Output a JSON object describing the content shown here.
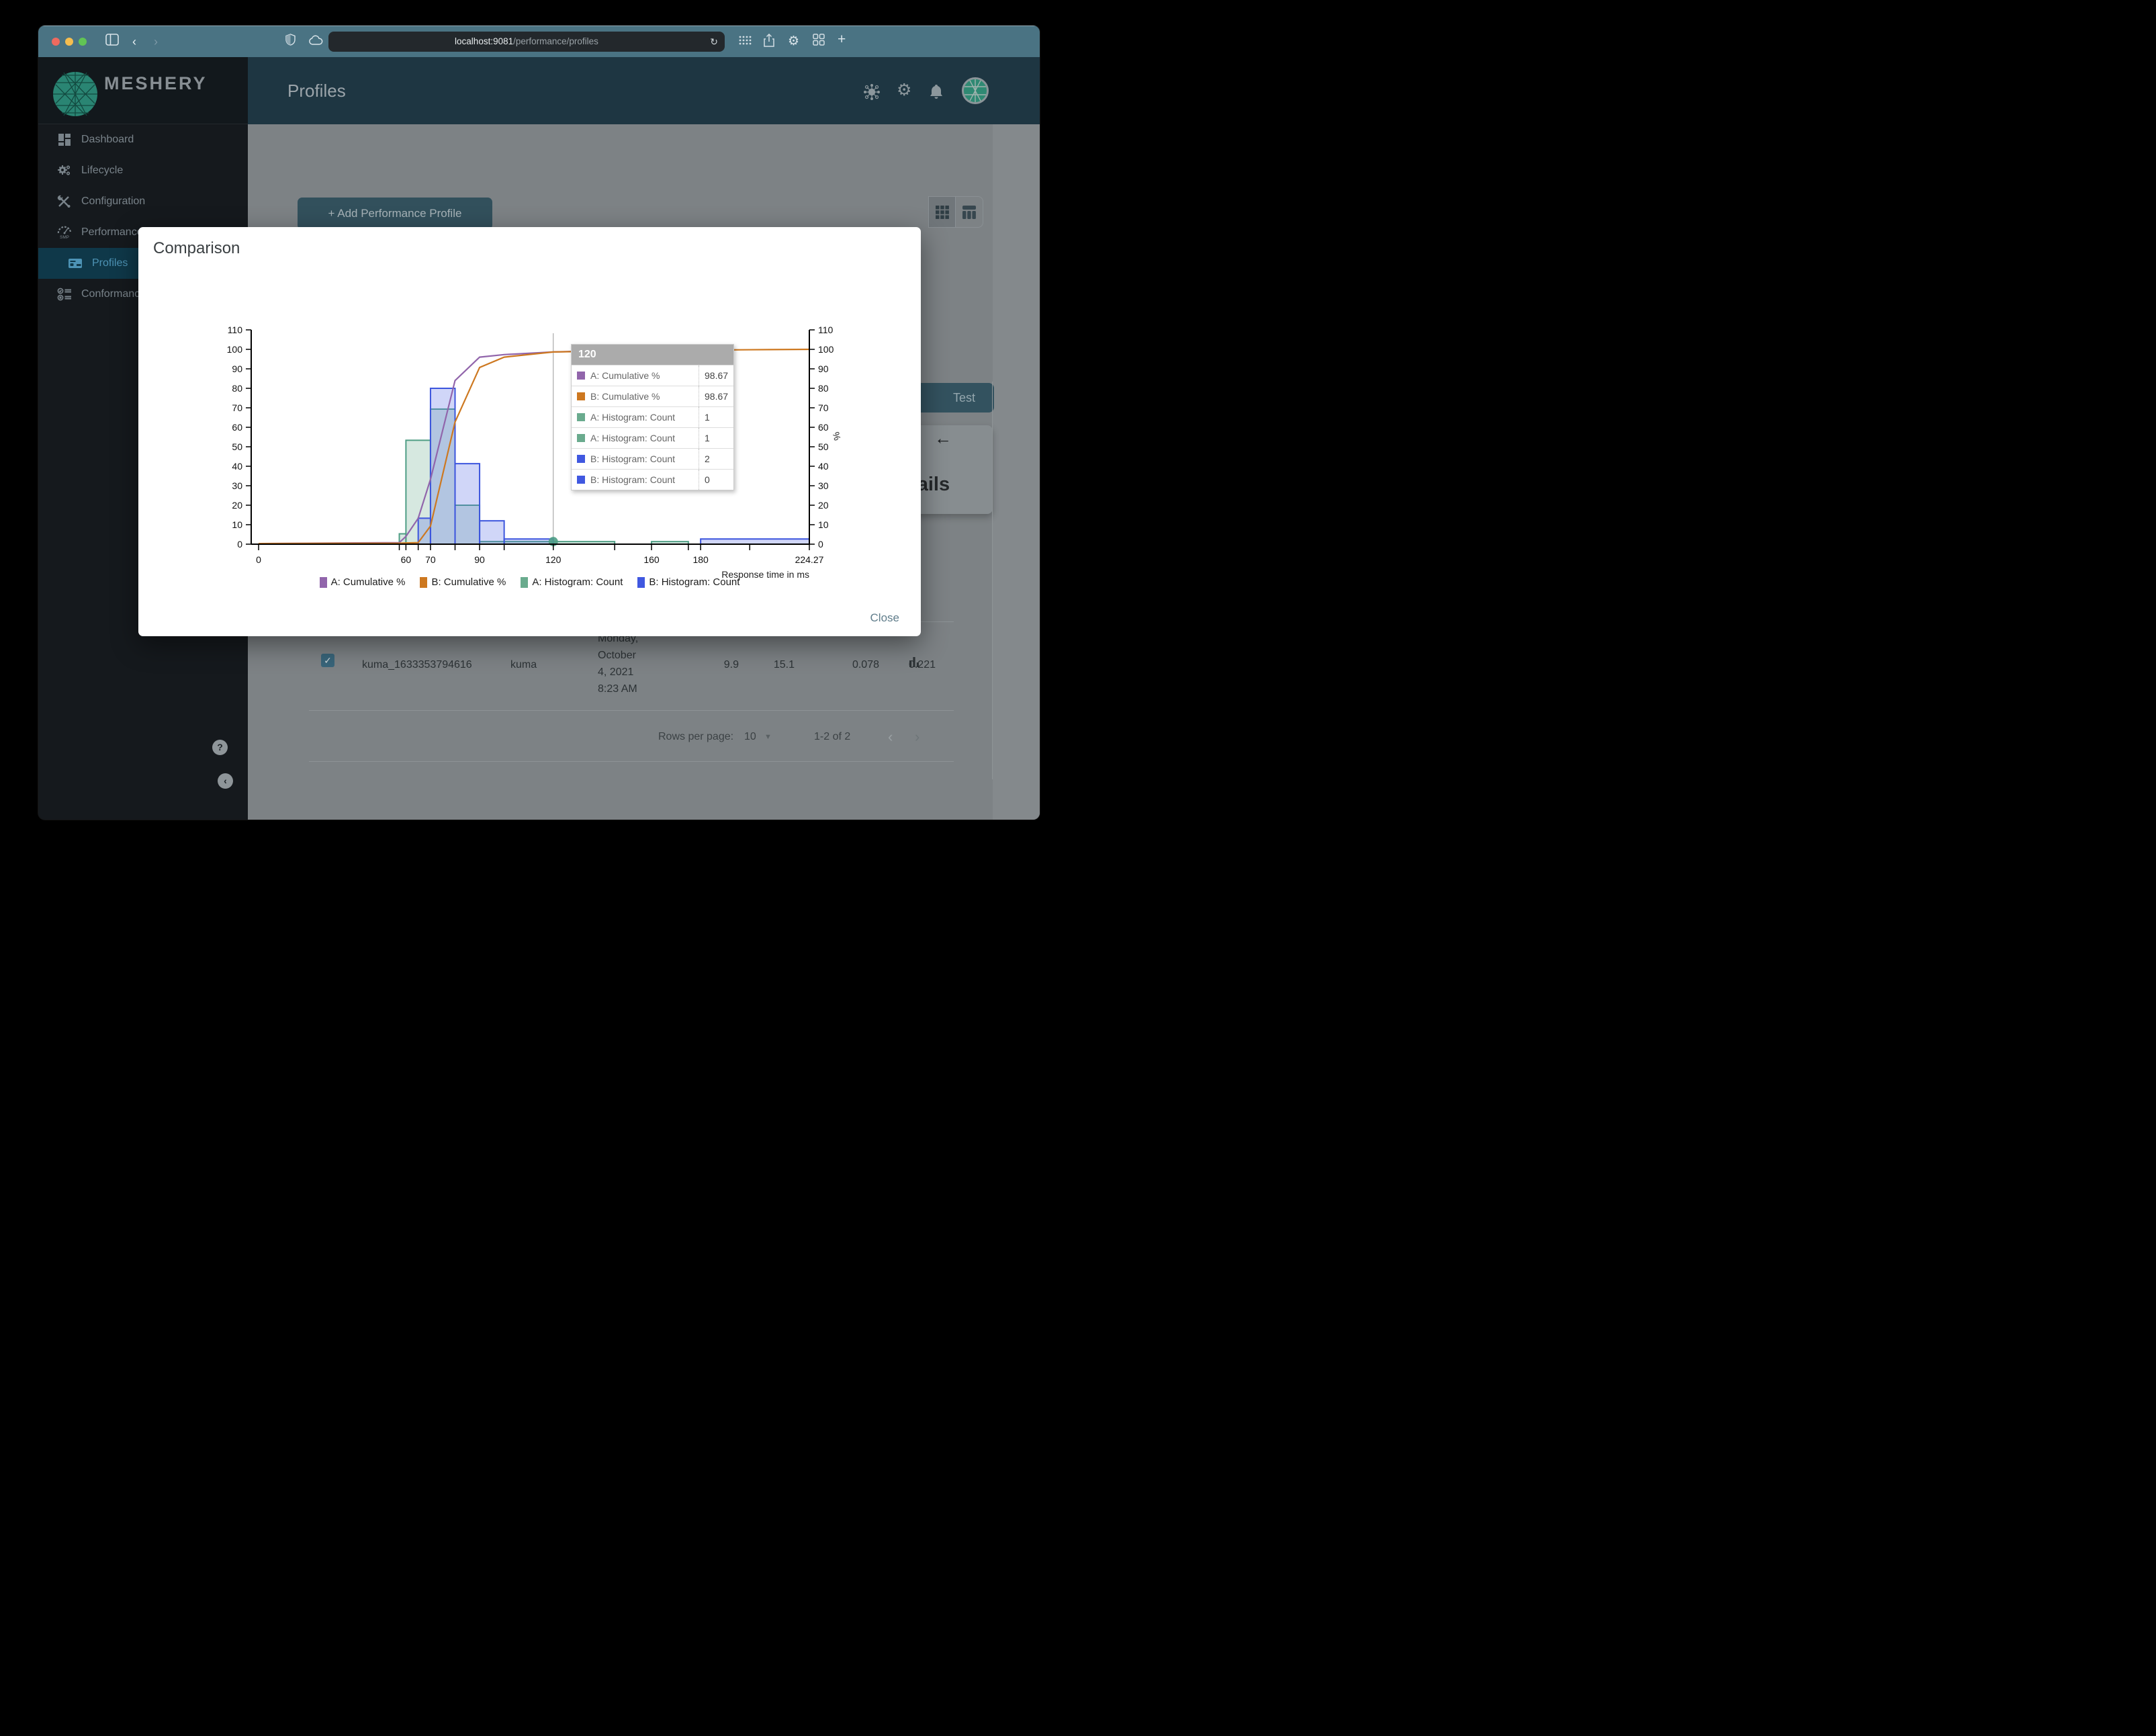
{
  "browser": {
    "url_host": "localhost:9081",
    "url_path": "/performance/profiles"
  },
  "sidebar": {
    "brand": "MESHERY",
    "items": [
      {
        "label": "Dashboard",
        "icon": "dashboard-icon",
        "active": false,
        "indent": false
      },
      {
        "label": "Lifecycle",
        "icon": "lifecycle-icon",
        "active": false,
        "indent": false
      },
      {
        "label": "Configuration",
        "icon": "configuration-icon",
        "active": false,
        "indent": false
      },
      {
        "label": "Performance",
        "icon": "performance-icon",
        "active": false,
        "indent": false
      },
      {
        "label": "Profiles",
        "icon": "profiles-icon",
        "active": true,
        "indent": true
      },
      {
        "label": "Conformance",
        "icon": "conformance-icon",
        "active": false,
        "indent": false
      }
    ],
    "help_label": "?",
    "collapse_label": "‹"
  },
  "header": {
    "title": "Profiles"
  },
  "content": {
    "add_profile_button": "+ Add Performance Profile",
    "test_button": "Test",
    "back_arrow": "←",
    "details_heading": "Details",
    "table_row": {
      "name": "kuma_1633353794616",
      "mesh": "kuma",
      "date_lines": [
        "Monday,",
        "October",
        "4, 2021",
        "8:23 AM"
      ],
      "qps": "9.9",
      "duration": "15.1",
      "p50": "0.078",
      "p99": "0.221"
    },
    "pagination": {
      "rows_per_page_label": "Rows per page:",
      "rows_per_page_value": "10",
      "range": "1-2 of 2",
      "prev": "‹",
      "next": "›"
    }
  },
  "modal": {
    "title": "Comparison",
    "close_label": "Close",
    "tooltip": {
      "title": "120",
      "rows": [
        {
          "name": "A: Cumulative %",
          "value": "98.67",
          "color": "#9165ab"
        },
        {
          "name": "B: Cumulative %",
          "value": "98.67",
          "color": "#cd7820"
        },
        {
          "name": "A: Histogram: Count",
          "value": "1",
          "color": "#6aab8e"
        },
        {
          "name": "A: Histogram: Count",
          "value": "1",
          "color": "#6aab8e"
        },
        {
          "name": "B: Histogram: Count",
          "value": "2",
          "color": "#4058e0"
        },
        {
          "name": "B: Histogram: Count",
          "value": "0",
          "color": "#4058e0"
        }
      ]
    }
  },
  "chart_data": {
    "type": "mixed: histogram bars + cumulative % lines",
    "title": "",
    "xlabel": "Response time in ms",
    "ylabel_right": "%",
    "xlim": [
      0,
      224.27
    ],
    "ylim": [
      0,
      110
    ],
    "x_tick_labels": [
      "0",
      "60",
      "70",
      "90",
      "120",
      "160",
      "180",
      "224.27"
    ],
    "x_tick_label_values": [
      0,
      60,
      70,
      90,
      120,
      160,
      180,
      224.27
    ],
    "x_minor_ticks": [
      0,
      57.3,
      60,
      65,
      70,
      80,
      90,
      100,
      120,
      145,
      160,
      175,
      180,
      200,
      224.27
    ],
    "y_ticks": [
      0,
      10,
      20,
      30,
      40,
      50,
      60,
      70,
      80,
      90,
      100,
      110
    ],
    "grid": "off",
    "legend_position": "bottom",
    "crosshair_x": 120,
    "marker": {
      "x": 120,
      "y": 1.33,
      "color": "#4f9e85"
    },
    "series": [
      {
        "name": "A: Histogram: Count",
        "type": "histogram",
        "color": "#4f9e85",
        "fill": "rgba(106,171,142,0.28)",
        "bins": [
          [
            57.3,
            60,
            5.33
          ],
          [
            60,
            70,
            53.33
          ],
          [
            70,
            80,
            69.33
          ],
          [
            80,
            90,
            20
          ],
          [
            90,
            100,
            1.33
          ],
          [
            100,
            120,
            1.33
          ],
          [
            120,
            145,
            1.33
          ],
          [
            160,
            175,
            1.33
          ]
        ]
      },
      {
        "name": "B: Histogram: Count",
        "type": "histogram",
        "color": "#3c55dd",
        "fill": "rgba(87,106,229,0.28)",
        "bins": [
          [
            65,
            70,
            13.33
          ],
          [
            70,
            80,
            80
          ],
          [
            80,
            90,
            41.33
          ],
          [
            90,
            100,
            12
          ],
          [
            100,
            120,
            2.67
          ],
          [
            180,
            224.27,
            2.67
          ]
        ]
      },
      {
        "name": "A: Cumulative %",
        "type": "line",
        "color": "#9165ab",
        "points": [
          [
            0,
            0.3
          ],
          [
            57.3,
            0.8
          ],
          [
            60,
            4
          ],
          [
            65,
            13.3
          ],
          [
            70,
            33.3
          ],
          [
            80,
            84
          ],
          [
            90,
            96
          ],
          [
            100,
            97.3
          ],
          [
            120,
            98.67
          ],
          [
            145,
            99.5
          ],
          [
            160,
            99.8
          ],
          [
            175,
            100.4
          ]
        ]
      },
      {
        "name": "B: Cumulative %",
        "type": "line",
        "color": "#cd7820",
        "points": [
          [
            0,
            0.3
          ],
          [
            57.3,
            0.5
          ],
          [
            60,
            0.6
          ],
          [
            65,
            0.8
          ],
          [
            70,
            9.3
          ],
          [
            80,
            62.7
          ],
          [
            90,
            90.7
          ],
          [
            100,
            96
          ],
          [
            120,
            98.67
          ],
          [
            145,
            99.2
          ],
          [
            160,
            99.4
          ],
          [
            180,
            99.6
          ],
          [
            200,
            99.8
          ],
          [
            224.27,
            100
          ]
        ]
      }
    ],
    "legend": [
      {
        "label": "A: Cumulative %",
        "color": "#9165ab"
      },
      {
        "label": "B: Cumulative %",
        "color": "#cd7820"
      },
      {
        "label": "A: Histogram: Count",
        "color": "#6aab8e"
      },
      {
        "label": "B: Histogram: Count",
        "color": "#4058e0"
      }
    ]
  }
}
